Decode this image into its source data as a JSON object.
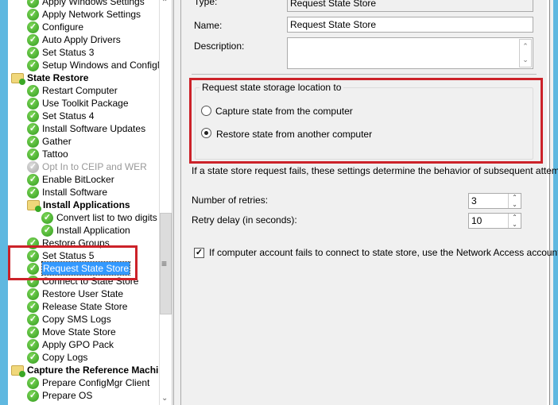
{
  "tree": {
    "items": [
      {
        "label": "Apply Windows Settings",
        "level": 1,
        "state": "ok"
      },
      {
        "label": "Apply Network Settings",
        "level": 1,
        "state": "ok"
      },
      {
        "label": "Configure",
        "level": 1,
        "state": "ok"
      },
      {
        "label": "Auto Apply Drivers",
        "level": 1,
        "state": "ok"
      },
      {
        "label": "Set Status 3",
        "level": 1,
        "state": "ok"
      },
      {
        "label": "Setup Windows and ConfigMgr",
        "level": 1,
        "state": "ok"
      },
      {
        "label": "State Restore",
        "level": 0,
        "state": "group"
      },
      {
        "label": "Restart Computer",
        "level": 1,
        "state": "ok"
      },
      {
        "label": "Use Toolkit Package",
        "level": 1,
        "state": "ok"
      },
      {
        "label": "Set Status 4",
        "level": 1,
        "state": "ok"
      },
      {
        "label": "Install Software Updates",
        "level": 1,
        "state": "ok"
      },
      {
        "label": "Gather",
        "level": 1,
        "state": "ok"
      },
      {
        "label": "Tattoo",
        "level": 1,
        "state": "ok"
      },
      {
        "label": "Opt In to CEIP and WER",
        "level": 1,
        "state": "disabled"
      },
      {
        "label": "Enable BitLocker",
        "level": 1,
        "state": "ok"
      },
      {
        "label": "Install Software",
        "level": 1,
        "state": "ok"
      },
      {
        "label": "Install Applications",
        "level": 1,
        "state": "group"
      },
      {
        "label": "Convert list to two digits",
        "level": 2,
        "state": "ok"
      },
      {
        "label": "Install Application",
        "level": 2,
        "state": "ok"
      },
      {
        "label": "Restore Groups",
        "level": 1,
        "state": "ok"
      },
      {
        "label": "Set Status 5",
        "level": 1,
        "state": "ok"
      },
      {
        "label": "Request State Store",
        "level": 1,
        "state": "selected"
      },
      {
        "label": "Connect to State Store",
        "level": 1,
        "state": "ok"
      },
      {
        "label": "Restore User State",
        "level": 1,
        "state": "ok"
      },
      {
        "label": "Release State Store",
        "level": 1,
        "state": "ok"
      },
      {
        "label": "Copy SMS Logs",
        "level": 1,
        "state": "ok"
      },
      {
        "label": "Move State Store",
        "level": 1,
        "state": "ok"
      },
      {
        "label": "Apply GPO Pack",
        "level": 1,
        "state": "ok"
      },
      {
        "label": "Copy Logs",
        "level": 1,
        "state": "ok"
      },
      {
        "label": "Capture the Reference Machi",
        "level": 0,
        "state": "group"
      },
      {
        "label": "Prepare ConfigMgr Client",
        "level": 1,
        "state": "ok"
      },
      {
        "label": "Prepare OS",
        "level": 1,
        "state": "ok"
      }
    ]
  },
  "props": {
    "type_label": "Type:",
    "type_value": "Request State Store",
    "name_label": "Name:",
    "name_value": "Request State Store",
    "description_label": "Description:",
    "description_value": "",
    "group_title": "Request state storage location to",
    "radio_capture": "Capture state from the computer",
    "radio_restore": "Restore state from another computer",
    "selected_option": "restore",
    "info_text": "If a state store request fails, these settings determine the behavior of subsequent attempts.",
    "retries_label": "Number of retries:",
    "retries_value": "3",
    "delay_label": "Retry delay (in seconds):",
    "delay_value": "10",
    "network_checkbox_label": "If computer account fails to connect to state store, use the Network Access account",
    "network_checkbox_checked": true
  },
  "colors": {
    "highlight": "#cc2229",
    "selection": "#3399ff"
  }
}
